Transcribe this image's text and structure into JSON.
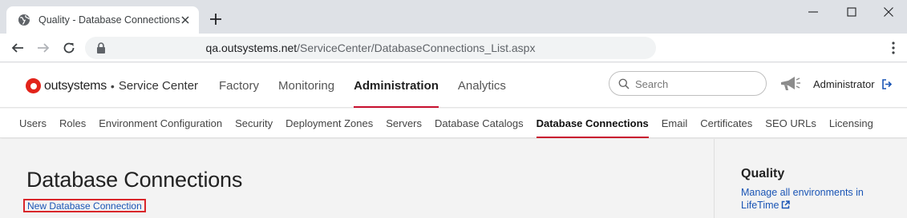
{
  "browser": {
    "tab_title": "Quality - Database Connections",
    "url_host": "qa.outsystems.net",
    "url_path": "/ServiceCenter/DatabaseConnections_List.aspx"
  },
  "header": {
    "brand": "outsystems",
    "separator": "•",
    "product": "Service Center",
    "nav": [
      "Factory",
      "Monitoring",
      "Administration",
      "Analytics"
    ],
    "active_nav": "Administration",
    "search_placeholder": "Search",
    "user": "Administrator",
    "accent_color": "#c8102e"
  },
  "subnav": {
    "items": [
      "Users",
      "Roles",
      "Environment Configuration",
      "Security",
      "Deployment Zones",
      "Servers",
      "Database Catalogs",
      "Database Connections",
      "Email",
      "Certificates",
      "SEO URLs",
      "Licensing"
    ],
    "active": "Database Connections"
  },
  "main": {
    "title": "Database Connections",
    "new_link": "New Database Connection"
  },
  "sidebar": {
    "environment": "Quality",
    "lifetime_link": "Manage all environments in LifeTime"
  },
  "icons": [
    "globe-icon",
    "close-icon",
    "plus-icon",
    "minimize-icon",
    "maximize-icon",
    "back-icon",
    "forward-icon",
    "reload-icon",
    "lock-icon",
    "kebab-menu-icon",
    "search-icon",
    "megaphone-icon",
    "logout-icon",
    "external-link-icon"
  ]
}
